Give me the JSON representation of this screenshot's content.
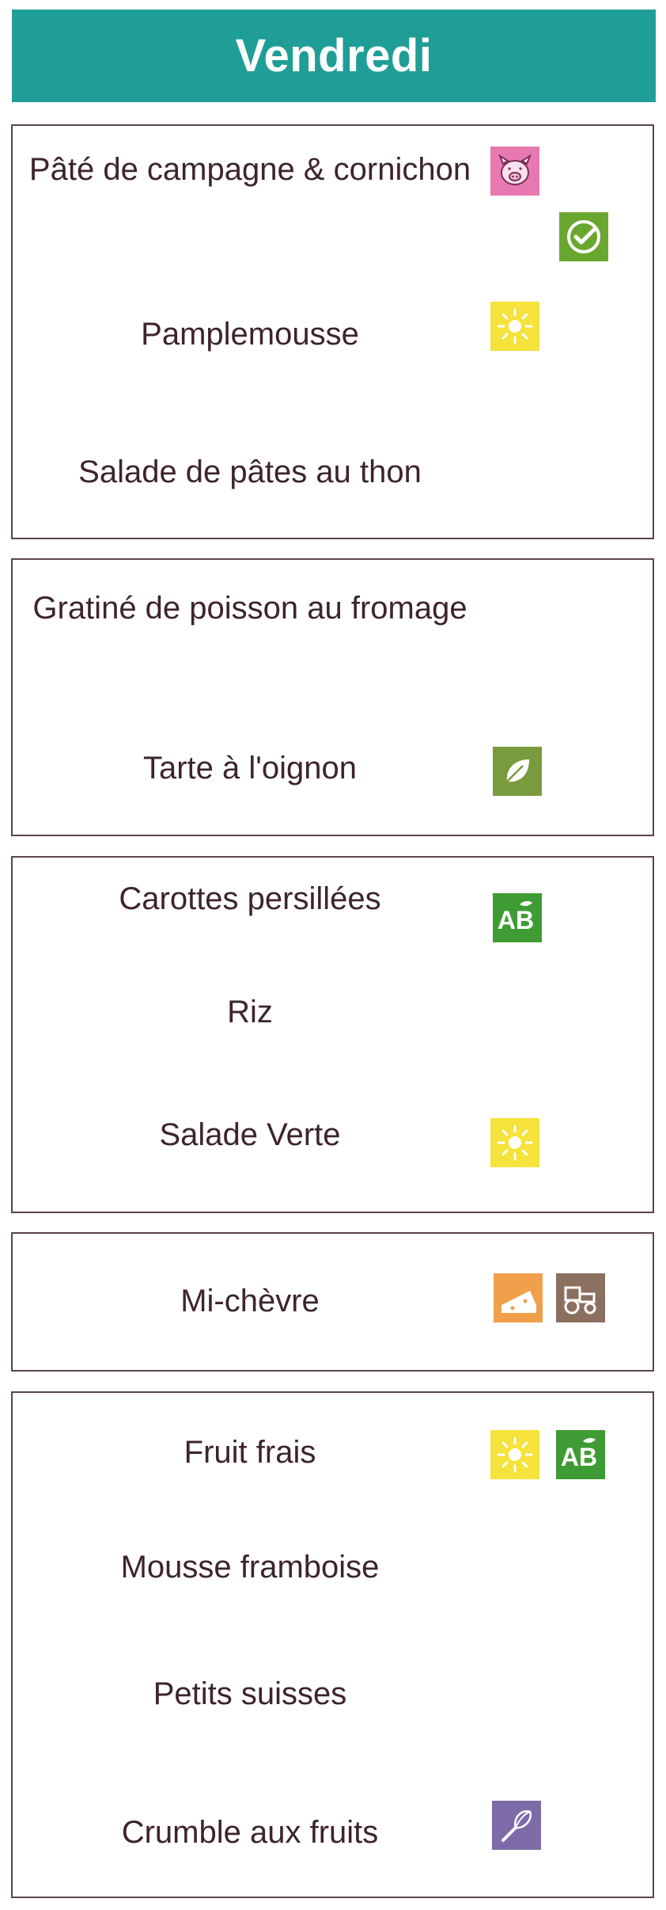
{
  "header": {
    "title": "Vendredi"
  },
  "sections": [
    {
      "items": [
        {
          "label": "Pâté de campagne & cornichon",
          "icons": [
            "pig-icon",
            "quality-check-icon"
          ]
        },
        {
          "label": "Pamplemousse",
          "icons": [
            "sun-icon"
          ]
        },
        {
          "label": "Salade de pâtes au thon",
          "icons": []
        }
      ]
    },
    {
      "items": [
        {
          "label": "Gratiné de poisson au fromage",
          "icons": []
        },
        {
          "label": "Tarte à l'oignon",
          "icons": [
            "vegetarian-leaf-icon"
          ]
        }
      ]
    },
    {
      "items": [
        {
          "label": "Carottes persillées",
          "icons": [
            "organic-ab-icon"
          ]
        },
        {
          "label": "Riz",
          "icons": []
        },
        {
          "label": "Salade Verte",
          "icons": [
            "sun-icon"
          ]
        }
      ]
    },
    {
      "items": [
        {
          "label": "Mi-chèvre",
          "icons": [
            "cheese-icon",
            "tractor-icon"
          ]
        }
      ]
    },
    {
      "items": [
        {
          "label": "Fruit frais",
          "icons": [
            "sun-icon",
            "organic-ab-icon"
          ]
        },
        {
          "label": "Mousse framboise",
          "icons": []
        },
        {
          "label": "Petits suisses",
          "icons": []
        },
        {
          "label": "Crumble aux fruits",
          "icons": [
            "homemade-whisk-icon"
          ]
        }
      ]
    }
  ],
  "colors": {
    "header_bg": "#1f9e97",
    "text": "#3d2330",
    "border": "#5a4450",
    "pig_bg": "#e879b0",
    "check_bg": "#6aa72f",
    "sun_bg": "#f5e23a",
    "leaf_bg": "#7a9a3e",
    "organic_bg": "#3f9b33",
    "cheese_bg": "#f0a04b",
    "tractor_bg": "#8b7060",
    "whisk_bg": "#7c6ba8"
  }
}
